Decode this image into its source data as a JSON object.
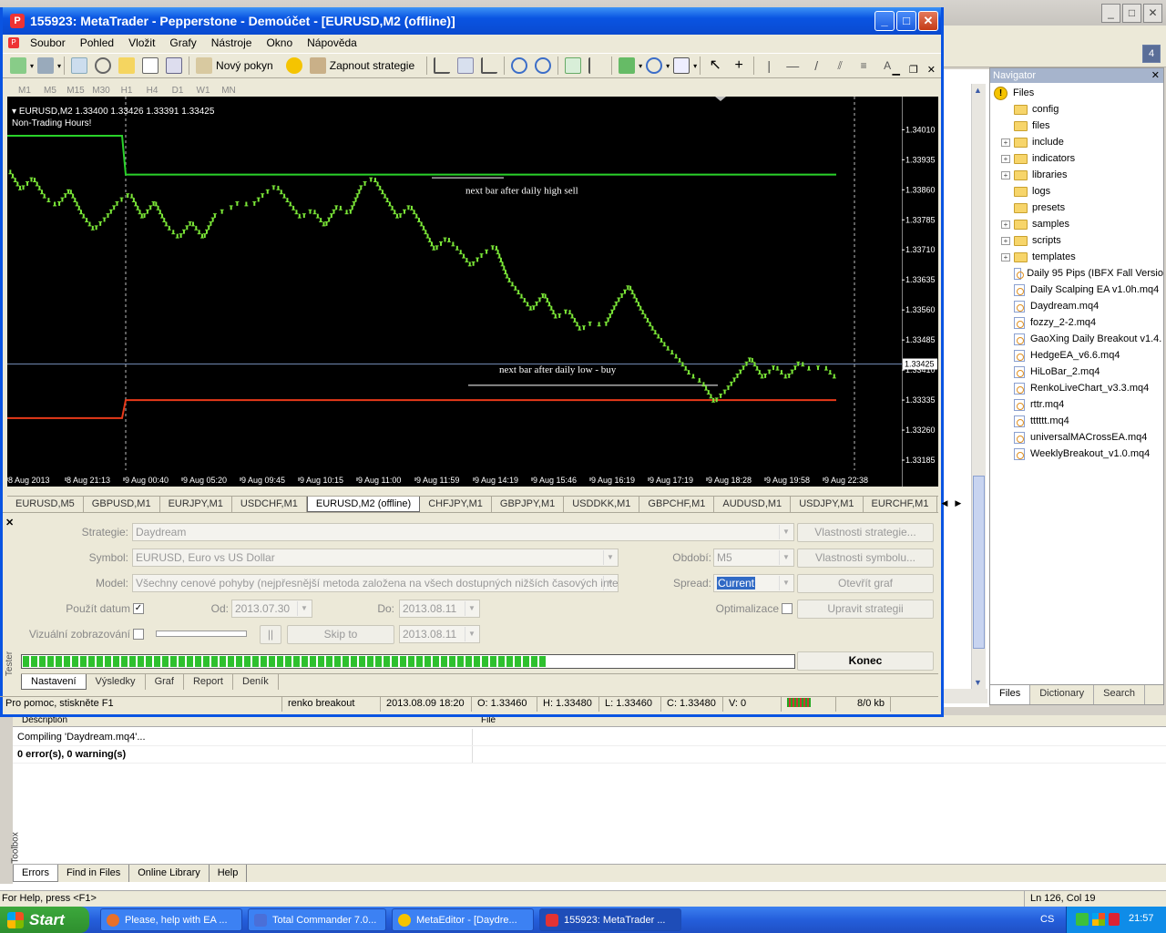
{
  "metaeditor": {
    "navigator": {
      "title": "Navigator",
      "root": "Files",
      "folders": [
        {
          "name": "config",
          "expandable": false
        },
        {
          "name": "files",
          "expandable": false
        },
        {
          "name": "include",
          "expandable": true
        },
        {
          "name": "indicators",
          "expandable": true
        },
        {
          "name": "libraries",
          "expandable": true
        },
        {
          "name": "logs",
          "expandable": false
        },
        {
          "name": "presets",
          "expandable": false
        },
        {
          "name": "samples",
          "expandable": true
        },
        {
          "name": "scripts",
          "expandable": true
        },
        {
          "name": "templates",
          "expandable": true
        }
      ],
      "files": [
        "Daily 95 Pips (IBFX Fall Versio",
        "Daily Scalping EA v1.0h.mq4",
        "Daydream.mq4",
        "fozzy_2-2.mq4",
        "GaoXing Daily Breakout v1.4.",
        "HedgeEA_v6.6.mq4",
        "HiLoBar_2.mq4",
        "RenkoLiveChart_v3.3.mq4",
        "rttr.mq4",
        "tttttt.mq4",
        "universalMACrossEA.mq4",
        "WeeklyBreakout_v1.0.mq4"
      ],
      "tabs": [
        "Files",
        "Dictionary",
        "Search"
      ]
    },
    "toolbar_badge": "4",
    "output": {
      "headers": [
        "Description",
        "File"
      ],
      "rows": [
        "Compiling 'Daydream.mq4'...",
        "0 error(s), 0 warning(s)"
      ],
      "tabs": [
        "Errors",
        "Find in Files",
        "Online Library",
        "Help"
      ],
      "side_label": "Toolbox"
    },
    "status": {
      "left": "For Help, press <F1>",
      "right": "Ln 126, Col 19"
    }
  },
  "taskbar": {
    "start": "Start",
    "tasks": [
      {
        "label": "Please, help with EA ...",
        "color": "#e8702a"
      },
      {
        "label": "Total Commander 7.0...",
        "color": "#4a6fd8"
      },
      {
        "label": "MetaEditor - [Daydre...",
        "color": "#f5c400"
      },
      {
        "label": "155923: MetaTrader ...",
        "color": "#e33333"
      }
    ],
    "lang": "CS",
    "time": "21:57"
  },
  "mt4": {
    "title": "155923: MetaTrader - Pepperstone - Demoúčet - [EURUSD,M2 (offline)]",
    "logo": "P",
    "menu": [
      "Soubor",
      "Pohled",
      "Vložit",
      "Grafy",
      "Nástroje",
      "Okno",
      "Nápověda"
    ],
    "toolbar": {
      "new_order": "Nový pokyn",
      "strategies": "Zapnout strategie"
    },
    "timeframes": [
      "M1",
      "M5",
      "M15",
      "M30",
      "H1",
      "H4",
      "D1",
      "W1",
      "MN"
    ],
    "chart": {
      "header": "EURUSD,M2  1.33400 1.33426 1.33391 1.33425",
      "non_trading": "Non-Trading Hours!",
      "annot_sell": "next bar after daily high sell",
      "annot_buy": "next bar after daily low - buy",
      "current_price": "1.33425",
      "current_price_under": "1.33410"
    },
    "chart_tabs": [
      "EURUSD,M5",
      "GBPUSD,M1",
      "EURJPY,M1",
      "USDCHF,M1",
      "EURUSD,M2 (offline)",
      "CHFJPY,M1",
      "GBPJPY,M1",
      "USDDKK,M1",
      "GBPCHF,M1",
      "AUDUSD,M1",
      "USDJPY,M1",
      "EURCHF,M1"
    ],
    "tester": {
      "side_label": "Tester",
      "strategy_label": "Strategie:",
      "strategy": "Daydream",
      "symbol_label": "Symbol:",
      "symbol": "EURUSD, Euro vs US Dollar",
      "model_label": "Model:",
      "model": "Všechny cenové pohyby (nejpřesnější metoda založena na všech dostupných nižších časových intervalech",
      "use_date_label": "Použít datum",
      "from_label": "Od:",
      "from": "2013.07.30",
      "to_label": "Do:",
      "to": "2013.08.11",
      "visual_label": "Vizuální zobrazování",
      "pause": "||",
      "skip": "Skip to",
      "skip_date": "2013.08.11",
      "period_label": "Období:",
      "period": "M5",
      "spread_label": "Spread:",
      "spread": "Current",
      "optim_label": "Optimalizace",
      "btn_expert": "Vlastnosti strategie...",
      "btn_symbol": "Vlastnosti symbolu...",
      "btn_chart": "Otevřít graf",
      "btn_modify": "Upravit strategii",
      "btn_stop": "Konec",
      "progress": 0.68,
      "tabs": [
        "Nastavení",
        "Výsledky",
        "Graf",
        "Report",
        "Deník"
      ]
    },
    "status": {
      "help": "Pro pomoc, stiskněte F1",
      "profile": "renko breakout",
      "time": "2013.08.09 18:20",
      "open": "O: 1.33460",
      "high": "H: 1.33480",
      "low": "L: 1.33460",
      "close": "C: 1.33480",
      "vol": "V: 0",
      "traffic": "8/0 kb"
    }
  },
  "chart_data": {
    "type": "line",
    "x": [
      "8 Aug 2013",
      "8 Aug 21:13",
      "9 Aug 00:40",
      "9 Aug 05:20",
      "9 Aug 09:45",
      "9 Aug 10:15",
      "9 Aug 11:00",
      "9 Aug 11:59",
      "9 Aug 14:19",
      "9 Aug 15:46",
      "9 Aug 16:19",
      "9 Aug 17:19",
      "9 Aug 18:28",
      "9 Aug 19:58",
      "9 Aug 22:38"
    ],
    "yticks": [
      "1.34010",
      "1.33935",
      "1.33860",
      "1.33785",
      "1.33710",
      "1.33635",
      "1.33560",
      "1.33485",
      "1.33410",
      "1.33335",
      "1.33260",
      "1.33185"
    ],
    "ylim": [
      1.3316,
      1.3407
    ],
    "series": [
      {
        "values": [
          1.3391,
          1.3386,
          1.3389,
          1.3384,
          1.3382,
          1.3386,
          1.338,
          1.3376,
          1.3379,
          1.3383,
          1.3385,
          1.3379,
          1.3383,
          1.3377,
          1.3374,
          1.3378,
          1.3374,
          1.338,
          1.3381,
          1.3383,
          1.3382,
          1.3385,
          1.3387,
          1.3383,
          1.3379,
          1.3381,
          1.3377,
          1.3382,
          1.338,
          1.3387,
          1.3389,
          1.3384,
          1.3379,
          1.3382,
          1.3377,
          1.3371,
          1.3374,
          1.3371,
          1.3367,
          1.337,
          1.3372,
          1.3364,
          1.336,
          1.3356,
          1.336,
          1.3354,
          1.3356,
          1.3351,
          1.3353,
          1.3352,
          1.3358,
          1.3362,
          1.3356,
          1.3351,
          1.3347,
          1.3344,
          1.334,
          1.3338,
          1.3333,
          1.3336,
          1.334,
          1.3344,
          1.3339,
          1.3342,
          1.3339,
          1.3343,
          1.3341,
          1.3342,
          1.3339
        ]
      }
    ],
    "lines": [
      {
        "name": "daily high",
        "value": 1.33898,
        "color": "#2ad22a"
      },
      {
        "name": "daily low",
        "value": 1.33335,
        "color": "#e83a1a"
      },
      {
        "name": "prev high",
        "value": 1.33995,
        "color": "#2ad22a"
      },
      {
        "name": "prev low",
        "value": 1.3329,
        "color": "#e83a1a"
      }
    ]
  }
}
